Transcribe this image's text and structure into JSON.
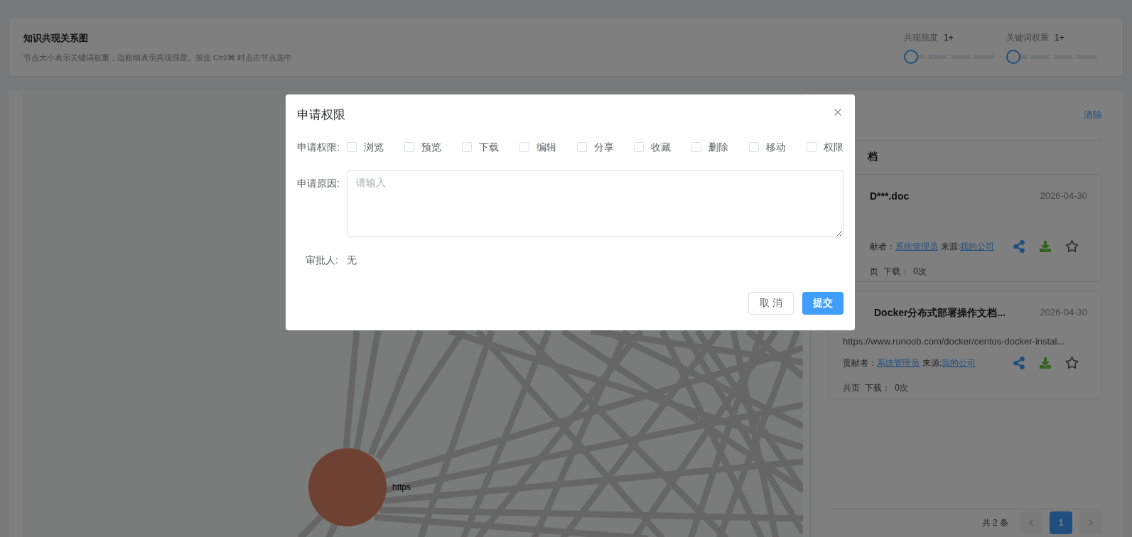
{
  "header": {
    "title": "知识共现关系图",
    "subtitle": "节点大小表示关键词权重，边粗细表示共现强度。按住 Ctrl/⌘ 时点击节点选中"
  },
  "sliders": [
    {
      "label": "共现强度",
      "value": "1+",
      "level": 0
    },
    {
      "label": "关键词权重",
      "value": "1+",
      "level": 0
    }
  ],
  "graph": {
    "node_label": "https"
  },
  "side_panel": {
    "clear_link": "清除",
    "section_title": "档",
    "cards": [
      {
        "title": "D***.doc",
        "date": "2026-04-30",
        "contributor_label": "献者：",
        "contributor": "系统管理员",
        "source_label": "来源:",
        "source": "我的公司",
        "stats": "页  下载：  0次"
      },
      {
        "title": "Docker分布式部署操作文档...",
        "date": "2026-04-30",
        "url": "https://www.runoob.com/docker/centos-docker-instal...",
        "contributor_label": "贡献者：",
        "contributor": "系统管理员",
        "source_label": "来源:",
        "source": "我的公司",
        "stats": "共页  下载：  0次"
      }
    ],
    "pagination": {
      "total": "共 2 条",
      "pages": [
        {
          "label": "1",
          "selected": true
        }
      ]
    }
  },
  "dialog": {
    "title": "申请权限",
    "permission_label": "申请权限:",
    "permissions": [
      {
        "label": "浏览",
        "checked": false
      },
      {
        "label": "预览",
        "checked": false
      },
      {
        "label": "下载",
        "checked": false
      },
      {
        "label": "编辑",
        "checked": false
      },
      {
        "label": "分享",
        "checked": false
      },
      {
        "label": "收藏",
        "checked": false
      },
      {
        "label": "删除",
        "checked": false
      },
      {
        "label": "移动",
        "checked": false
      },
      {
        "label": "权限",
        "checked": false
      }
    ],
    "reason_label": "申请原因:",
    "reason_placeholder": "请输入",
    "approver_label": "审批人:",
    "approver": "无",
    "buttons": [
      {
        "label": "取 消",
        "kind": "secondary"
      },
      {
        "label": "提交",
        "kind": "primary"
      }
    ]
  }
}
